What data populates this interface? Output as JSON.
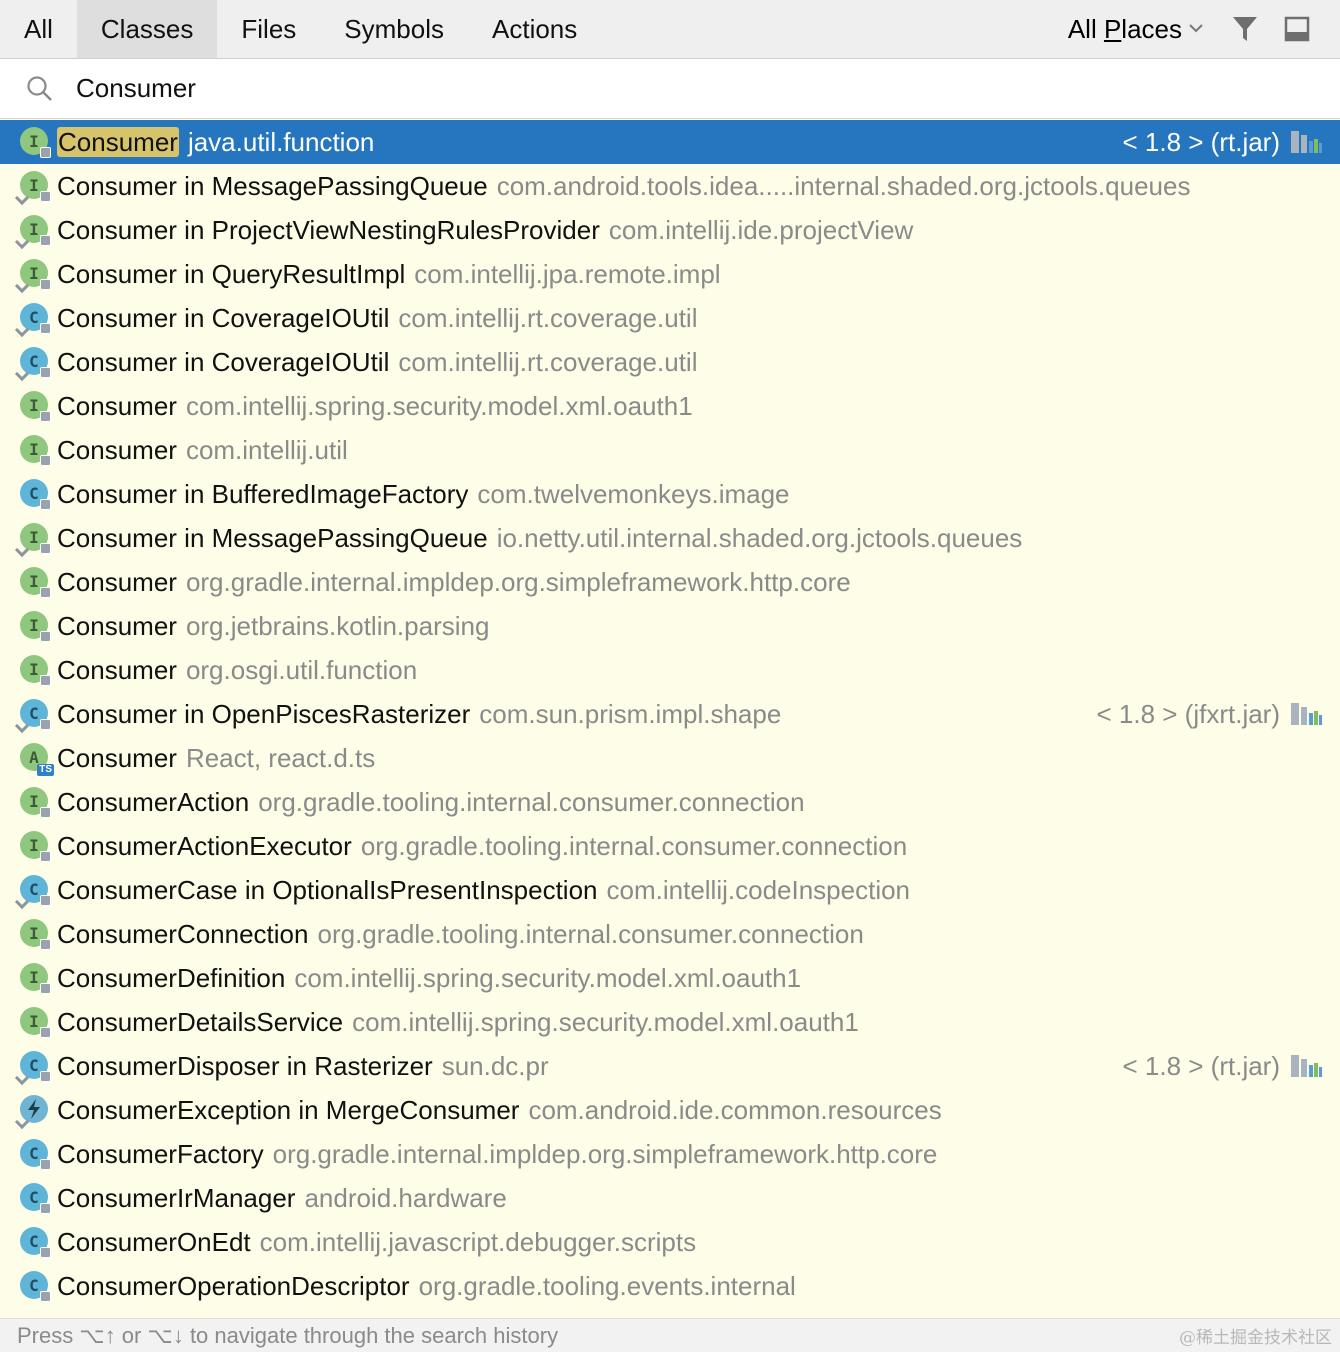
{
  "tabs": [
    {
      "label": "All"
    },
    {
      "label": "Classes",
      "active": true
    },
    {
      "label": "Files"
    },
    {
      "label": "Symbols"
    },
    {
      "label": "Actions"
    }
  ],
  "scope": {
    "prefix": "All ",
    "underlined": "P",
    "suffix": "laces"
  },
  "toolbar_icons": [
    "filter-icon",
    "preview-panel-icon"
  ],
  "search": {
    "value": "Consumer",
    "icon": "search-icon"
  },
  "results": [
    {
      "icon": "interface",
      "match": "Consumer",
      "rest": "",
      "pkg": "java.util.function",
      "loc": "< 1.8 > (rt.jar)",
      "selected": true,
      "lock": true
    },
    {
      "icon": "interface",
      "match": "Consumer",
      "rest": " in MessagePassingQueue",
      "pkg": "com.android.tools.idea.....internal.shaded.org.jctools.queues",
      "pin": true,
      "lock": true
    },
    {
      "icon": "interface",
      "match": "Consumer",
      "rest": " in ProjectViewNestingRulesProvider",
      "pkg": "com.intellij.ide.projectView",
      "pin": true,
      "lock": true
    },
    {
      "icon": "interface",
      "match": "Consumer",
      "rest": " in QueryResultImpl",
      "pkg": "com.intellij.jpa.remote.impl",
      "pin": true,
      "lock": true
    },
    {
      "icon": "class",
      "match": "Consumer",
      "rest": " in CoverageIOUtil",
      "pkg": "com.intellij.rt.coverage.util",
      "pin": true,
      "lock": true
    },
    {
      "icon": "class",
      "match": "Consumer",
      "rest": " in CoverageIOUtil",
      "pkg": "com.intellij.rt.coverage.util",
      "pin": true,
      "lock": true
    },
    {
      "icon": "interface",
      "match": "Consumer",
      "rest": "",
      "pkg": "com.intellij.spring.security.model.xml.oauth1",
      "lock": true
    },
    {
      "icon": "interface",
      "match": "Consumer",
      "rest": "",
      "pkg": "com.intellij.util",
      "lock": true
    },
    {
      "icon": "class",
      "match": "Consumer",
      "rest": " in BufferedImageFactory",
      "pkg": "com.twelvemonkeys.image",
      "lock": true
    },
    {
      "icon": "interface",
      "match": "Consumer",
      "rest": " in MessagePassingQueue",
      "pkg": "io.netty.util.internal.shaded.org.jctools.queues",
      "pin": true,
      "lock": true
    },
    {
      "icon": "interface",
      "match": "Consumer",
      "rest": "",
      "pkg": "org.gradle.internal.impldep.org.simpleframework.http.core",
      "lock": true
    },
    {
      "icon": "interface",
      "match": "Consumer",
      "rest": "",
      "pkg": "org.jetbrains.kotlin.parsing",
      "lock": true
    },
    {
      "icon": "interface",
      "match": "Consumer",
      "rest": "",
      "pkg": "org.osgi.util.function",
      "lock": true
    },
    {
      "icon": "class",
      "match": "Consumer",
      "rest": " in OpenPiscesRasterizer",
      "pkg": "com.sun.prism.impl.shape",
      "loc": "< 1.8 > (jfxrt.jar)",
      "pin": true,
      "lock": true
    },
    {
      "icon": "ts",
      "match": "Consumer",
      "rest": "",
      "pkg": "React, react.d.ts"
    },
    {
      "icon": "interface",
      "match": "Consumer",
      "rest": "Action",
      "pkg": "org.gradle.tooling.internal.consumer.connection",
      "lock": true
    },
    {
      "icon": "interface",
      "match": "Consumer",
      "rest": "ActionExecutor",
      "pkg": "org.gradle.tooling.internal.consumer.connection",
      "lock": true
    },
    {
      "icon": "class",
      "match": "Consumer",
      "rest": "Case in OptionalIsPresentInspection",
      "pkg": "com.intellij.codeInspection",
      "pin": true,
      "lock": true
    },
    {
      "icon": "interface",
      "match": "Consumer",
      "rest": "Connection",
      "pkg": "org.gradle.tooling.internal.consumer.connection",
      "lock": true
    },
    {
      "icon": "interface",
      "match": "Consumer",
      "rest": "Definition",
      "pkg": "com.intellij.spring.security.model.xml.oauth1",
      "lock": true
    },
    {
      "icon": "interface",
      "match": "Consumer",
      "rest": "DetailsService",
      "pkg": "com.intellij.spring.security.model.xml.oauth1",
      "lock": true
    },
    {
      "icon": "class",
      "match": "Consumer",
      "rest": "Disposer in Rasterizer",
      "pkg": "sun.dc.pr",
      "loc": "< 1.8 > (rt.jar)",
      "pin": true,
      "lock": true
    },
    {
      "icon": "exception",
      "match": "Consumer",
      "rest": "Exception in MergeConsumer",
      "pkg": "com.android.ide.common.resources",
      "pin": true
    },
    {
      "icon": "class",
      "match": "Consumer",
      "rest": "Factory",
      "pkg": "org.gradle.internal.impldep.org.simpleframework.http.core",
      "lock": true
    },
    {
      "icon": "class",
      "match": "Consumer",
      "rest": "IrManager",
      "pkg": "android.hardware",
      "lock": true
    },
    {
      "icon": "class",
      "match": "Consumer",
      "rest": "OnEdt",
      "pkg": "com.intellij.javascript.debugger.scripts",
      "lock": true
    },
    {
      "icon": "class",
      "match": "Consumer",
      "rest": "OperationDescriptor",
      "pkg": "org.gradle.tooling.events.internal",
      "lock": true
    }
  ],
  "footer": {
    "hint": "Press ⌥↑ or ⌥↓ to navigate through the search history",
    "watermark": "@稀土掘金技术社区"
  },
  "colors": {
    "selection": "#2675bf",
    "list_bg": "#fdfde8",
    "match_highlight": "#d6c36a",
    "interface_icon": "#8fc77e",
    "class_icon": "#5fb5d8"
  }
}
